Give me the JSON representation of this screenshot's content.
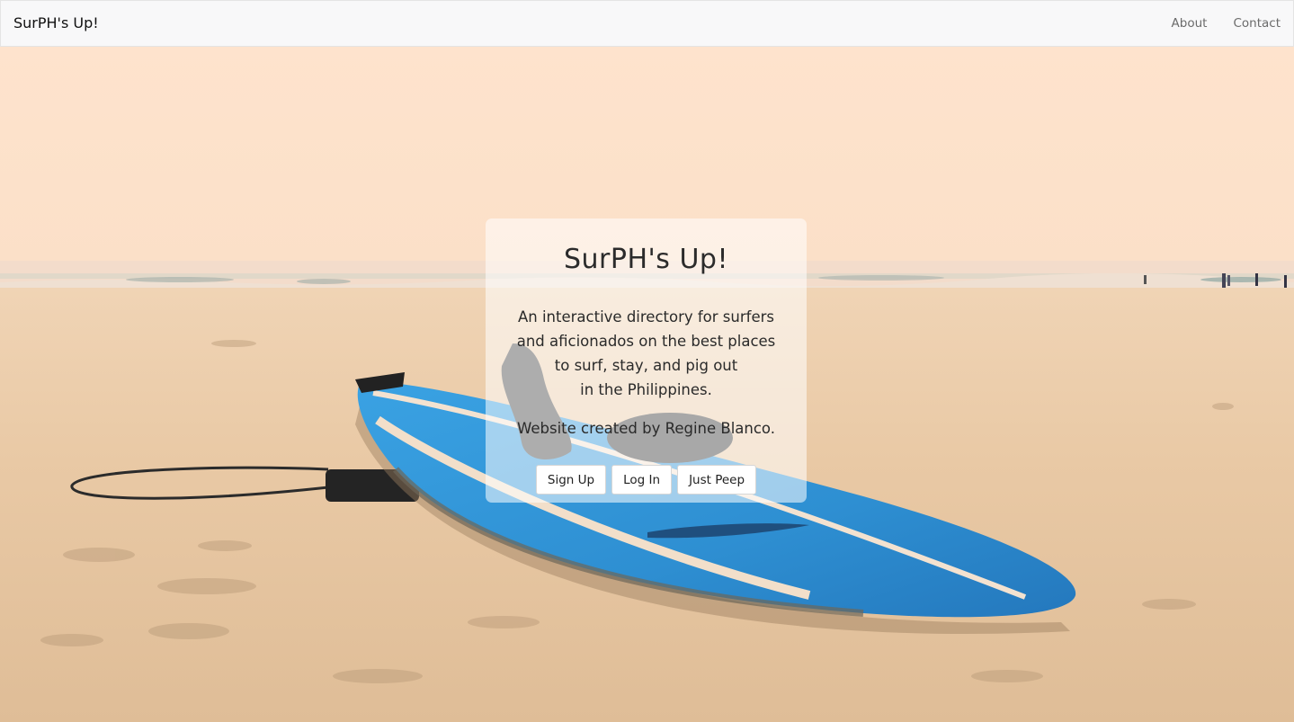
{
  "navbar": {
    "brand": "SurPH's Up!",
    "links": [
      {
        "label": "About"
      },
      {
        "label": "Contact"
      }
    ]
  },
  "hero": {
    "title": "SurPH's Up!",
    "description_lines": [
      "An interactive directory for surfers",
      "and aficionados on the best places",
      "to surf, stay, and pig out",
      "in the Philippines."
    ],
    "credit": "Website created by Regine Blanco.",
    "buttons": [
      {
        "label": "Sign Up"
      },
      {
        "label": "Log In"
      },
      {
        "label": "Just Peep"
      }
    ]
  },
  "colors": {
    "navbar_bg": "#f8f8f9",
    "sky": "#fde3cc",
    "sand": "#e7c8a4",
    "surfboard": "#2f8fd1"
  }
}
